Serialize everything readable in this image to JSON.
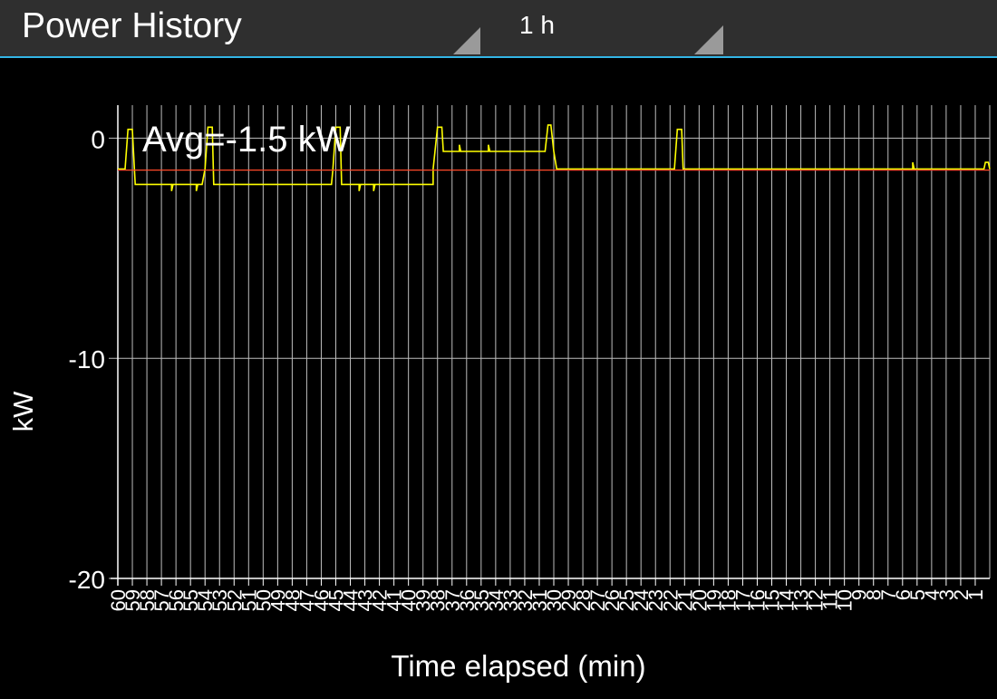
{
  "header": {
    "title": "Power History",
    "range_value": "1 h",
    "accent_color": "#33b5e5"
  },
  "chart_data": {
    "type": "line",
    "ylabel": "kW",
    "xlabel": "Time elapsed (min)",
    "ylim": [
      -20,
      1.5
    ],
    "yticks": [
      0,
      -10,
      -20
    ],
    "xlim": [
      60,
      0
    ],
    "x_ticks_every": 1,
    "x_tick_labels_shown": [
      60,
      59,
      58,
      57,
      56,
      55,
      54,
      53,
      52,
      51,
      50,
      49,
      48,
      47,
      46,
      45,
      44,
      43,
      42,
      41,
      40,
      39,
      38,
      37,
      36,
      35,
      34,
      33,
      32,
      31,
      30,
      29,
      28,
      27,
      26,
      25,
      24,
      23,
      22,
      21,
      20,
      19,
      18,
      17,
      16,
      15,
      14,
      13,
      12,
      11,
      10,
      9,
      8,
      7,
      6,
      5,
      4,
      3,
      2,
      1
    ],
    "grid": true,
    "annotation": "Avg=-1.5 kW",
    "series": [
      {
        "color": "#ffff00",
        "points": [
          [
            60,
            -1.4
          ],
          [
            59.5,
            -1.4
          ],
          [
            59.3,
            0.4
          ],
          [
            59.0,
            0.4
          ],
          [
            58.8,
            -2.1
          ],
          [
            58.0,
            -2.1
          ],
          [
            56.3,
            -2.1
          ],
          [
            56.3,
            -2.4
          ],
          [
            56.2,
            -2.1
          ],
          [
            54.6,
            -2.1
          ],
          [
            54.6,
            -2.4
          ],
          [
            54.5,
            -2.1
          ],
          [
            54.2,
            -2.1
          ],
          [
            54.0,
            -1.4
          ],
          [
            53.8,
            0.5
          ],
          [
            53.5,
            0.5
          ],
          [
            53.4,
            -2.1
          ],
          [
            45.3,
            -2.1
          ],
          [
            45.2,
            -1.4
          ],
          [
            45.0,
            0.5
          ],
          [
            44.7,
            0.5
          ],
          [
            44.6,
            -2.1
          ],
          [
            43.4,
            -2.1
          ],
          [
            43.4,
            -2.4
          ],
          [
            43.3,
            -2.1
          ],
          [
            42.4,
            -2.1
          ],
          [
            42.4,
            -2.4
          ],
          [
            42.3,
            -2.1
          ],
          [
            38.3,
            -2.1
          ],
          [
            38.3,
            -1.4
          ],
          [
            38.0,
            0.5
          ],
          [
            37.7,
            0.5
          ],
          [
            37.6,
            -0.6
          ],
          [
            36.5,
            -0.6
          ],
          [
            36.5,
            -0.3
          ],
          [
            36.4,
            -0.6
          ],
          [
            34.5,
            -0.6
          ],
          [
            34.5,
            -0.3
          ],
          [
            34.4,
            -0.6
          ],
          [
            30.6,
            -0.6
          ],
          [
            30.4,
            0.6
          ],
          [
            30.2,
            0.6
          ],
          [
            30.0,
            -0.6
          ],
          [
            29.8,
            -1.4
          ],
          [
            21.7,
            -1.4
          ],
          [
            21.5,
            0.4
          ],
          [
            21.2,
            0.4
          ],
          [
            21.1,
            -1.4
          ],
          [
            5.3,
            -1.4
          ],
          [
            5.3,
            -1.1
          ],
          [
            5.2,
            -1.4
          ],
          [
            0.4,
            -1.4
          ],
          [
            0.3,
            -1.1
          ],
          [
            0.1,
            -1.1
          ],
          [
            0,
            -1.4
          ]
        ]
      },
      {
        "color": "#ff4a2a",
        "points": [
          [
            60,
            -1.45
          ],
          [
            0,
            -1.45
          ]
        ]
      }
    ]
  }
}
